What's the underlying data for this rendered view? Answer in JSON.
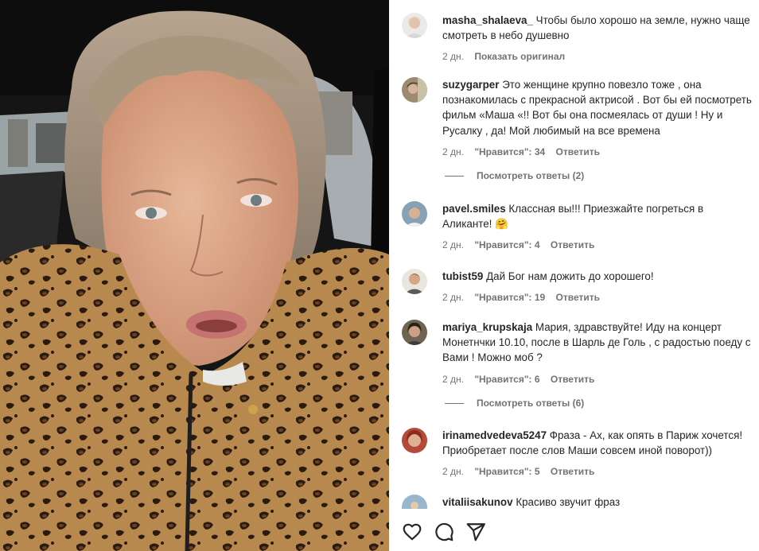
{
  "comments": [
    {
      "username": "masha_shalaeva_",
      "text": "Чтобы было хорошо на земле, нужно чаще смотреть в небо душевно",
      "time": "2 дн.",
      "extra": "Показать оригинал"
    },
    {
      "username": "suzygarper",
      "text": "Это женщине крупно повезло тоже , она познакомилась с прекрасной актрисой . Вот бы ей посмотреть фильм «Маша «!! Вот бы она посмеялась от души ! Ну и Русалку , да! Мой любимый на все времена",
      "time": "2 дн.",
      "likes": "\"Нравится\": 34",
      "reply": "Ответить",
      "view_replies": "Посмотреть ответы (2)"
    },
    {
      "username": "pavel.smiles",
      "text": "Классная вы!!! Приезжайте погреться в Аликанте! 🤗",
      "time": "2 дн.",
      "likes": "\"Нравится\": 4",
      "reply": "Ответить"
    },
    {
      "username": "tubist59",
      "text": "Дай Бог нам дожить до хорошего!",
      "time": "2 дн.",
      "likes": "\"Нравится\": 19",
      "reply": "Ответить"
    },
    {
      "username": "mariya_krupskaja",
      "text": "Мария, здравствуйте! Иду на концерт Монетнчки 10.10, после в Шарль де Голь , с радостью поеду с Вами ! Можно моб ?",
      "time": "2 дн.",
      "likes": "\"Нравится\": 6",
      "reply": "Ответить",
      "view_replies": "Посмотреть ответы (6)"
    },
    {
      "username": "irinamedvedeva5247",
      "text": "Фраза - Ах, как опять в Париж хочется! Приобретает после слов Маши совсем иной поворот))",
      "time": "2 дн.",
      "likes": "\"Нравится\": 5",
      "reply": "Ответить"
    },
    {
      "username": "vitaliisakunov",
      "text": "Красиво звучит фраз"
    }
  ],
  "actions": {
    "like_icon": "heart-icon",
    "comment_icon": "comment-icon",
    "share_icon": "share-icon"
  },
  "colors": {
    "secondary_text": "#737373",
    "primary_text": "#262626",
    "leopard_base": "#b8894e"
  }
}
